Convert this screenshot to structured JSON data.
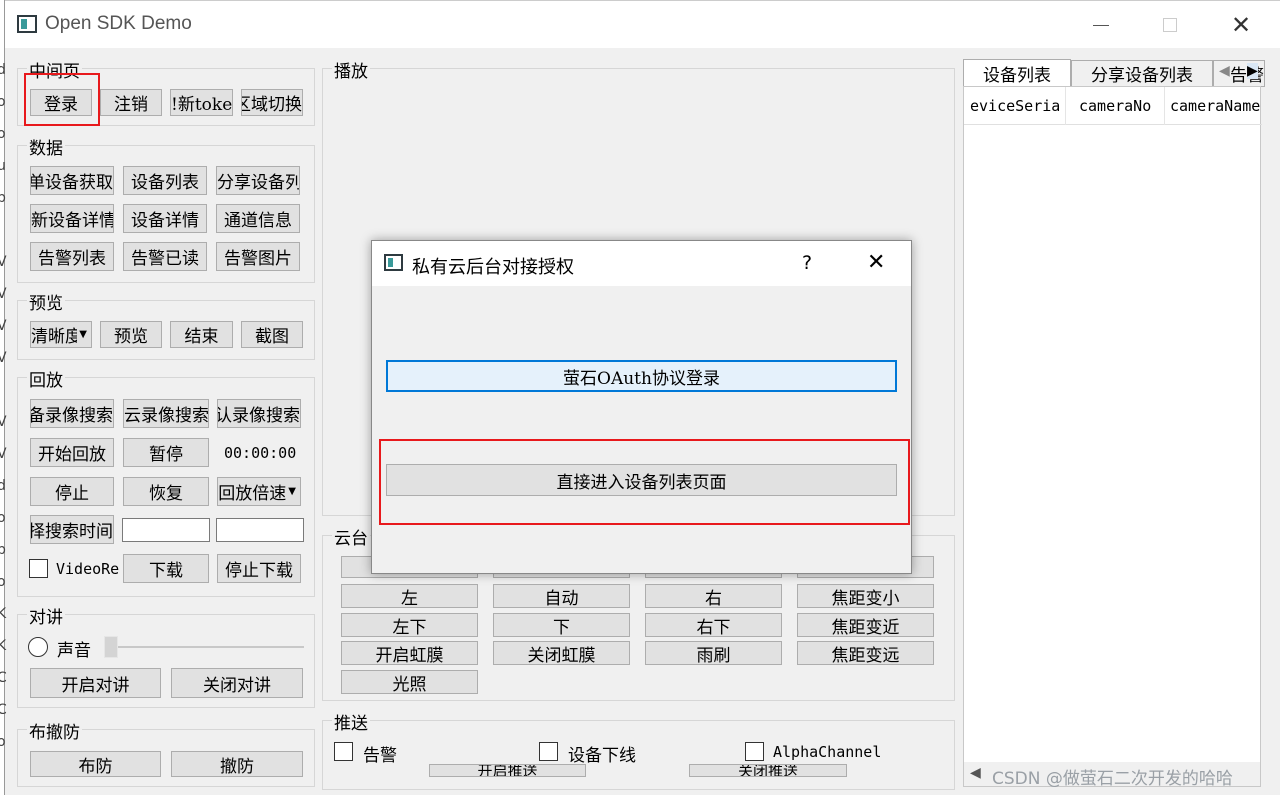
{
  "window": {
    "title": "Open SDK Demo"
  },
  "middle": {
    "title": "中间页",
    "login": "登录",
    "logout": "注销",
    "refresh_token": "!新toke",
    "region_switch": "区域切换"
  },
  "data_group": {
    "title": "数据",
    "single_device": "单设备获取",
    "device_list": "设备列表",
    "share_list": "分享设备列表",
    "new_device_detail": "新设备详情",
    "device_detail": "设备详情",
    "channel_info": "通道信息",
    "alarm_list": "告警列表",
    "alarm_read": "告警已读",
    "alarm_picture": "告警图片"
  },
  "preview": {
    "title": "预览",
    "definition": "清晰度切换",
    "preview": "预览",
    "stop": "结束",
    "screenshot": "截图"
  },
  "playback": {
    "title": "回放",
    "device_search": "设备录像搜索",
    "cloud_search": "云录像搜索",
    "default_search": "默认录像搜索",
    "start": "开始回放",
    "pause": "暂停",
    "time": "00:00:00",
    "stop": "停止",
    "resume": "恢复",
    "speed": "回放倍速",
    "select_time": "选择搜索时间",
    "video_record": "VideoRe",
    "download": "下载",
    "stop_download": "停止下载"
  },
  "talk": {
    "title": "对讲",
    "sound": "声音",
    "open": "开启对讲",
    "close": "关闭对讲"
  },
  "defense": {
    "title": "布撤防",
    "arm": "布防",
    "disarm": "撤防"
  },
  "play": {
    "title": "播放"
  },
  "ptz": {
    "title": "云台",
    "left": "左",
    "auto": "自动",
    "right": "右",
    "zoom_small": "焦距变小",
    "left_down": "左下",
    "down": "下",
    "right_down": "右下",
    "focus_near": "焦距变近",
    "iris_open": "开启虹膜",
    "iris_close": "关闭虹膜",
    "wiper": "雨刷",
    "focus_far": "焦距变远",
    "light": "光照"
  },
  "push": {
    "title": "推送",
    "alarm": "告警",
    "offline": "设备下线",
    "alpha": "AlphaChannel",
    "start": "开启推送",
    "stop": "关闭推送"
  },
  "right_panel": {
    "tabs": [
      "设备列表",
      "分享设备列表",
      "告警"
    ],
    "columns": [
      "eviceSeria",
      "cameraNo",
      "cameraName"
    ]
  },
  "dialog": {
    "title": "私有云后台对接授权",
    "help": "?",
    "oauth": "萤石OAuth协议登录",
    "direct": "直接进入设备列表页面"
  },
  "watermark": "CSDN @做萤石二次开发的哈哈",
  "left_edge_chars": [
    "J",
    "d",
    "o",
    "o",
    "u",
    "p",
    "l",
    "V",
    "V",
    "V",
    "V",
    "l",
    "V",
    "V",
    "d",
    "o",
    "p",
    "o",
    "K",
    "K",
    "C",
    "C",
    "o"
  ]
}
